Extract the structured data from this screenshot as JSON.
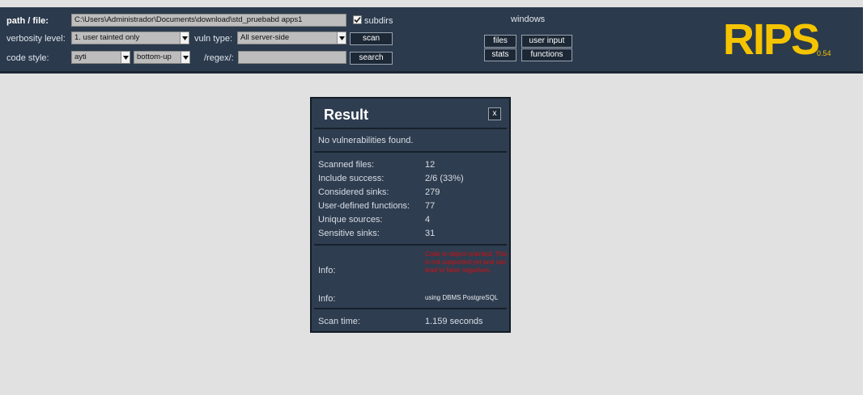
{
  "toolbar": {
    "path_label": "path / file:",
    "path_value": "C:\\Users\\Administrador\\Documents\\download\\std_pruebabd apps1",
    "subdirs_label": "subdirs",
    "subdirs_checked": true,
    "verbosity_label": "verbosity level:",
    "verbosity_value": "1. user tainted only",
    "vuln_type_label": "vuln type:",
    "vuln_type_value": "All server-side",
    "scan_label": "scan",
    "code_style_label": "code style:",
    "code_style_value": "ayti",
    "order_value": "bottom-up",
    "regex_label": "/regex/:",
    "regex_value": "",
    "search_label": "search",
    "windows_label": "windows",
    "files_label": "files",
    "user_input_label": "user input",
    "stats_label": "stats",
    "functions_label": "functions"
  },
  "logo": {
    "text": "RIPS",
    "version": "0.54",
    "color": "#f5c400"
  },
  "result": {
    "title": "Result",
    "close_label": "x",
    "summary": "No vulnerabilities found.",
    "stats": [
      {
        "label": "Scanned files:",
        "value": "12"
      },
      {
        "label": "Include success:",
        "value": "2/6 (33%)"
      },
      {
        "label": "Considered sinks:",
        "value": "279"
      },
      {
        "label": "User-defined functions:",
        "value": "77"
      },
      {
        "label": "Unique sources:",
        "value": "4"
      },
      {
        "label": "Sensitive sinks:",
        "value": "31"
      }
    ],
    "info1_label": "Info:",
    "info1_value": "Code is object-oriented. This is not supported yet and can lead to false negatives.",
    "info2_label": "Info:",
    "info2_value": "using DBMS PostgreSQL",
    "scan_time_label": "Scan time:",
    "scan_time_value": "1.159 seconds"
  },
  "colors": {
    "toolbar_bg": "#2b3a4c",
    "page_bg": "#e1e1e1",
    "dialog_bg": "#2f3d50",
    "warning": "#d01010"
  }
}
